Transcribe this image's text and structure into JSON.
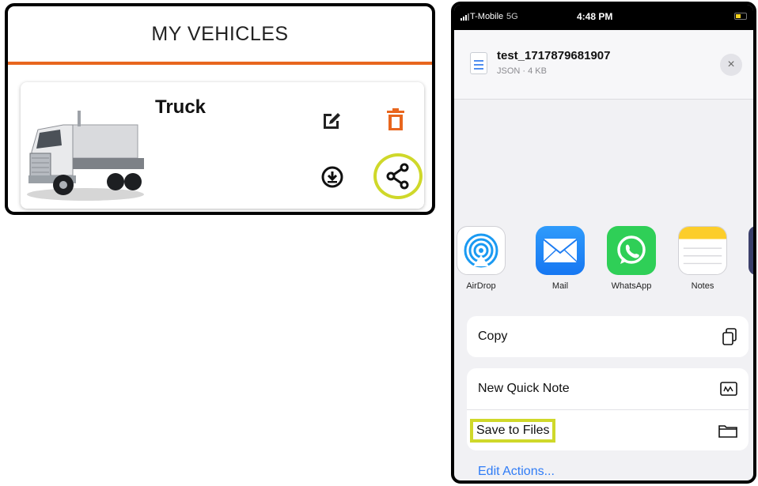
{
  "vehicles": {
    "title": "MY VEHICLES",
    "card": {
      "name": "Truck",
      "image_alt": "truck",
      "icons": [
        "edit-icon",
        "delete-icon",
        "download-icon",
        "share-icon"
      ]
    },
    "accent_color": "#e8661e",
    "highlight_color": "#cfd82a"
  },
  "share_sheet": {
    "status_bar": {
      "carrier": "T-Mobile",
      "network": "5G",
      "time": "4:48 PM"
    },
    "file": {
      "name": "test_1717879681907",
      "meta": "JSON · 4 KB"
    },
    "close_label": "×",
    "apps": [
      {
        "label": "AirDrop",
        "icon": "airdrop-icon"
      },
      {
        "label": "Mail",
        "icon": "mail-icon"
      },
      {
        "label": "WhatsApp",
        "icon": "whatsapp-icon"
      },
      {
        "label": "Notes",
        "icon": "notes-icon"
      }
    ],
    "actions": {
      "copy": "Copy",
      "quick_note": "New Quick Note",
      "save_to_files": "Save to Files"
    },
    "edit_actions": "Edit Actions..."
  }
}
